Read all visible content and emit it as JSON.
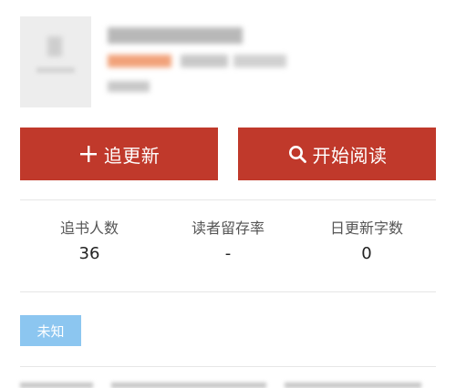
{
  "actions": {
    "follow": {
      "icon": "plus-icon",
      "label": "追更新"
    },
    "read": {
      "icon": "search-icon",
      "label": "开始阅读"
    }
  },
  "stats": [
    {
      "label": "追书人数",
      "value": "36"
    },
    {
      "label": "读者留存率",
      "value": "-"
    },
    {
      "label": "日更新字数",
      "value": "0"
    }
  ],
  "tag": {
    "label": "未知",
    "color": "#8cc6f0"
  },
  "colors": {
    "accent": "#c0392b",
    "tag": "#8cc6f0"
  }
}
